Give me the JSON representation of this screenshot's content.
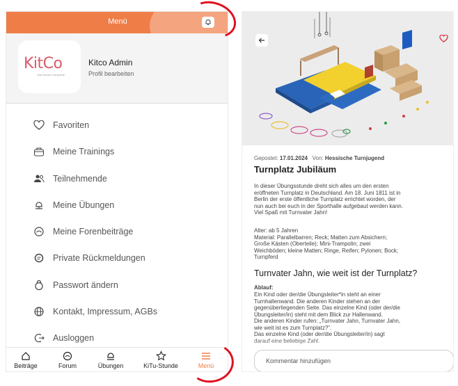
{
  "header": {
    "title": "Menü"
  },
  "profile": {
    "logo_text": "KitCo",
    "logo_sub": "Das Kinder-Lernportal",
    "name": "Kitco Admin",
    "edit_label": "Profil bearbeiten"
  },
  "menu": {
    "items": [
      {
        "label": "Favoriten",
        "icon": "heart-icon"
      },
      {
        "label": "Meine Trainings",
        "icon": "training-icon"
      },
      {
        "label": "Teilnehmende",
        "icon": "people-icon"
      },
      {
        "label": "Meine Übungen",
        "icon": "exercise-icon"
      },
      {
        "label": "Meine Forenbeiträge",
        "icon": "forum-post-icon"
      },
      {
        "label": "Private Rückmeldungen",
        "icon": "feedback-icon"
      },
      {
        "label": "Passwort ändern",
        "icon": "lock-icon"
      },
      {
        "label": "Kontakt, Impressum, AGBs",
        "icon": "globe-icon"
      },
      {
        "label": "Ausloggen",
        "icon": "logout-icon"
      }
    ]
  },
  "bottom_nav": {
    "items": [
      {
        "label": "Beiträge",
        "icon": "home-icon"
      },
      {
        "label": "Forum",
        "icon": "forum-icon"
      },
      {
        "label": "Übungen",
        "icon": "exercise-icon"
      },
      {
        "label": "KiTu-Stunde",
        "icon": "star-icon"
      },
      {
        "label": "Menü",
        "icon": "menu-icon"
      }
    ],
    "active": "Menü"
  },
  "article": {
    "posted_label": "Gepostet:",
    "date": "17.01.2024",
    "from_label": "Von:",
    "author": "Hessische Turnjugend",
    "title": "Turnplatz Jubiläum",
    "intro": "In dieser Übungsstunde dreht sich alles um den ersten\neröffneten Turnplatz in Deutschland. Am 18. Juni 1811 ist in\nBerlin der erste öffentliche Turnplatz errichtet worden, der\nnun auch bei euch in der Sporthalle aufgebaut werden kann.\nViel Spaß mit Turnvater Jahn!",
    "details": "Alter: ab 5 Jahren\nMaterial: Parallelbarren; Reck; Matten zum Absichern;\nGroße Kästen (Oberteile); Mini-Trampolin; zwei\nWeichböden; kleine Matten; Ringe, Reifen; Pylonen; Bock;\nTurnpferd",
    "section_title": "Turnvater Jahn, wie weit ist der Turnplatz?",
    "ablauf_label": "Ablauf:",
    "ablauf": "Ein Kind oder der/die Übungsleiter*in steht an einer\nTurnhallenwand. Die anderen Kinder stehen an der\ngegenüberliegenden Seite. Das einzelne Kind (oder der/die\nÜbungsleiter/in) steht mit dem Blick zur Hallenwand.\nDie anderen Kinder rufen: „Turnvater Jahn, Turnvater Jahn,\nwie weit ist es zum Turnplatz?\".\nDas einzelne Kind (oder der/die Übungsleiter/in) sagt\ndarauf eine beliebige Zahl.",
    "comment_placeholder": "Kommentar hinzufügen"
  },
  "colors": {
    "accent": "#ef7d48",
    "accent_light": "#f4a47e",
    "highlight_ring": "#e01020"
  }
}
